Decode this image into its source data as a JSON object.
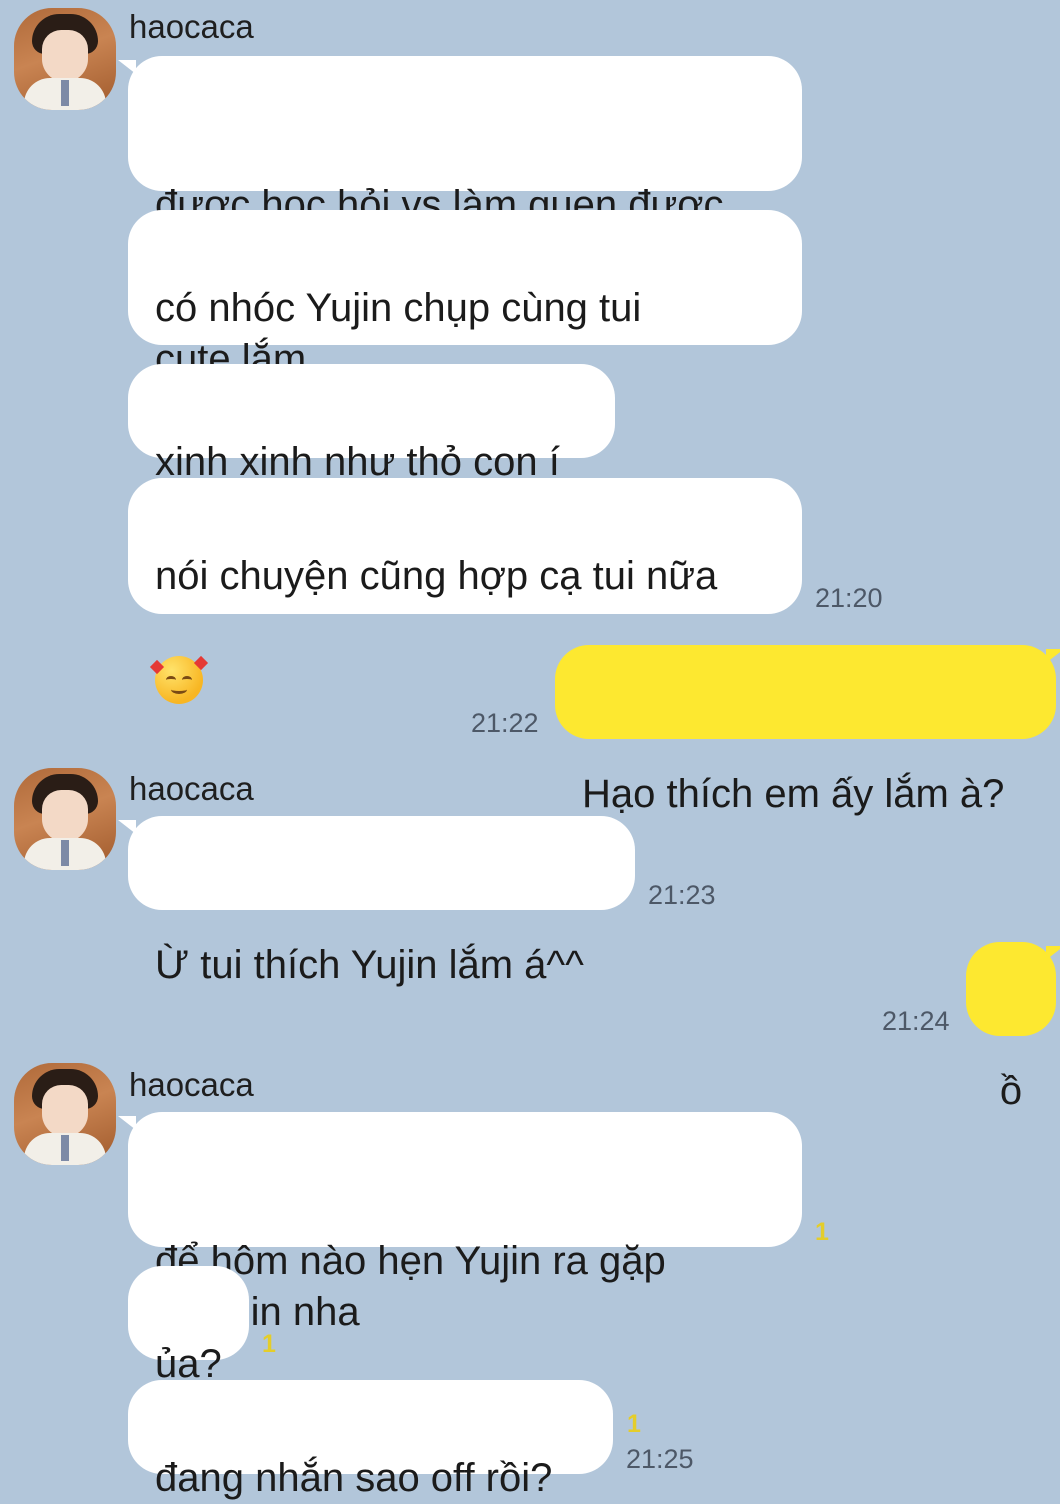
{
  "colors": {
    "background": "#b2c6da",
    "incoming_bubble": "#ffffff",
    "outgoing_bubble": "#fde830",
    "unread": "#e4cd2a"
  },
  "contact": {
    "name": "haocaca",
    "avatar": "avatar-photo"
  },
  "groups": [
    {
      "sender": "haocaca",
      "messages": [
        {
          "text": "được học hỏi vs làm quen được\nnhiều người nè"
        },
        {
          "text": "có nhóc Yujin chụp cùng tui\ncute lắm"
        },
        {
          "text": "xinh xinh như thỏ con í"
        },
        {
          "text": "nói chuyện cũng hợp cạ tui nữa",
          "emoji": "smiling-face-with-hearts-emoji",
          "time": "21:20"
        }
      ]
    },
    {
      "sender": "me",
      "messages": [
        {
          "text": "Hạo thích em ấy lắm à?",
          "time": "21:22"
        }
      ]
    },
    {
      "sender": "haocaca",
      "messages": [
        {
          "text": "Ừ tui thích Yujin lắm á^^",
          "time": "21:23"
        }
      ]
    },
    {
      "sender": "me",
      "messages": [
        {
          "text": "ồ",
          "time": "21:24"
        }
      ]
    },
    {
      "sender": "haocaca",
      "messages": [
        {
          "text": "để hôm nào hẹn Yujin ra gặp\nHanbin nha",
          "unread": "1"
        },
        {
          "text": "ủa?",
          "unread": "1"
        },
        {
          "text": "đang nhắn sao off rồi?",
          "unread": "1",
          "time": "21:25"
        }
      ]
    }
  ]
}
